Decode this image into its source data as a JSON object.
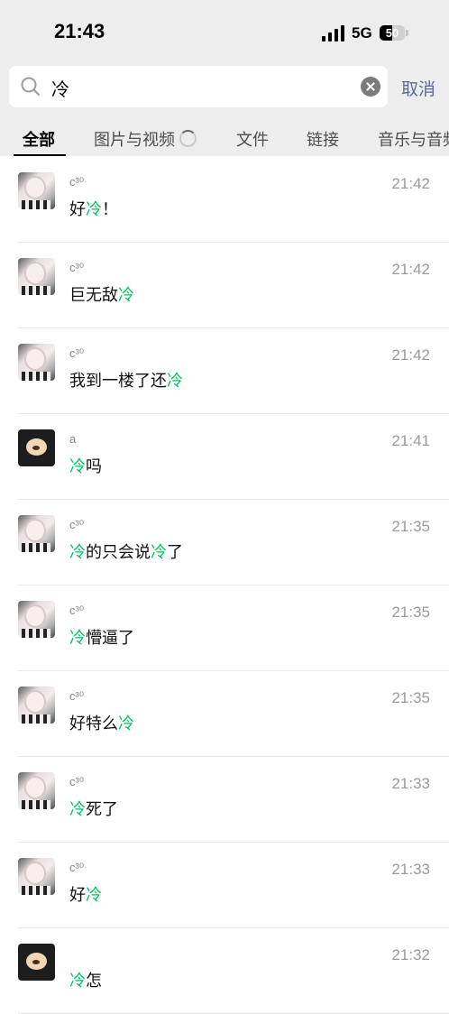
{
  "status_bar": {
    "time": "21:43",
    "network": "5G",
    "battery": "50",
    "battery_level": 0.5
  },
  "search": {
    "query": "冷",
    "cancel_label": "取消"
  },
  "tabs": [
    {
      "label": "全部",
      "active": true
    },
    {
      "label": "图片与视频",
      "active": false
    },
    {
      "label": "文件",
      "active": false
    },
    {
      "label": "链接",
      "active": false
    },
    {
      "label": "音乐与音频",
      "active": false
    }
  ],
  "results": [
    {
      "sender": "c³⁰",
      "avatar": "girl-photo",
      "time": "21:42",
      "msg": [
        "好",
        "冷",
        "！"
      ]
    },
    {
      "sender": "c³⁰",
      "avatar": "girl-photo",
      "time": "21:42",
      "msg": [
        "巨无敌",
        "冷",
        ""
      ]
    },
    {
      "sender": "c³⁰",
      "avatar": "girl-photo",
      "time": "21:42",
      "msg": [
        "我到一楼了还",
        "冷",
        ""
      ]
    },
    {
      "sender": "a",
      "avatar": "bear-photo",
      "time": "21:41",
      "msg": [
        "",
        "冷",
        "吗"
      ]
    },
    {
      "sender": "c³⁰",
      "avatar": "girl-photo",
      "time": "21:35",
      "msg": [
        "",
        "冷",
        "的只会说",
        "冷",
        "了"
      ]
    },
    {
      "sender": "c³⁰",
      "avatar": "girl-photo",
      "time": "21:35",
      "msg": [
        "",
        "冷",
        "懵逼了"
      ]
    },
    {
      "sender": "c³⁰",
      "avatar": "girl-photo",
      "time": "21:35",
      "msg": [
        "好特么",
        "冷",
        ""
      ]
    },
    {
      "sender": "c³⁰",
      "avatar": "girl-photo",
      "time": "21:33",
      "msg": [
        "",
        "冷",
        "死了"
      ]
    },
    {
      "sender": "c³⁰",
      "avatar": "girl-photo",
      "time": "21:33",
      "msg": [
        "好",
        "冷",
        ""
      ]
    },
    {
      "sender": "",
      "avatar": "bear-photo",
      "time": "21:32",
      "msg": [
        "",
        "冷",
        "怎"
      ]
    }
  ],
  "colors": {
    "highlight": "#07c160",
    "cancel": "#576b95",
    "timestamp": "#9a9a9a",
    "top_bg": "#ededed"
  }
}
